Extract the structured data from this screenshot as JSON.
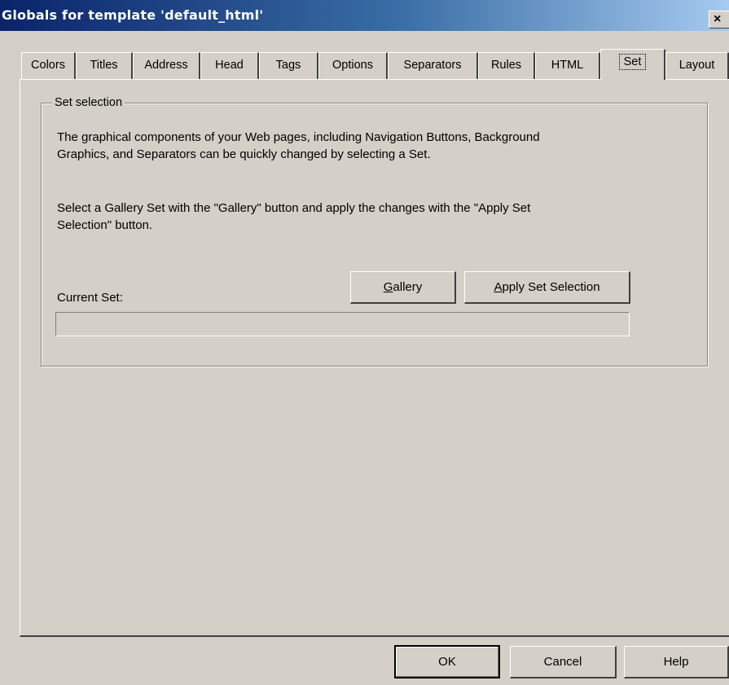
{
  "window": {
    "title": "Globals for template 'default_html'",
    "close_glyph": "×"
  },
  "tabs": [
    {
      "label": "Colors",
      "active": false
    },
    {
      "label": "Titles",
      "active": false
    },
    {
      "label": "Address",
      "active": false
    },
    {
      "label": "Head",
      "active": false
    },
    {
      "label": "Tags",
      "active": false
    },
    {
      "label": "Options",
      "active": false
    },
    {
      "label": "Separators",
      "active": false
    },
    {
      "label": "Rules",
      "active": false
    },
    {
      "label": "HTML",
      "active": false
    },
    {
      "label": "Set",
      "active": true
    },
    {
      "label": "Layout",
      "active": false
    }
  ],
  "set_group": {
    "label": "Set selection",
    "description_line1": "The graphical components of your Web pages, including Navigation Buttons, Background",
    "description_line2": "Graphics, and Separators can be quickly changed by selecting a Set.",
    "instruction_line1": "Select a Gallery Set with the \"Gallery\" button and apply the changes with the \"Apply Set",
    "instruction_line2": "Selection\" button.",
    "current_set_label": "Current Set:",
    "current_set_value": "",
    "gallery_button": {
      "mnemonic": "G",
      "rest": "allery"
    },
    "apply_button": {
      "mnemonic": "A",
      "rest": "pply Set Selection"
    }
  },
  "footer": {
    "ok_label": "OK",
    "cancel_label": "Cancel",
    "help_label": "Help"
  }
}
